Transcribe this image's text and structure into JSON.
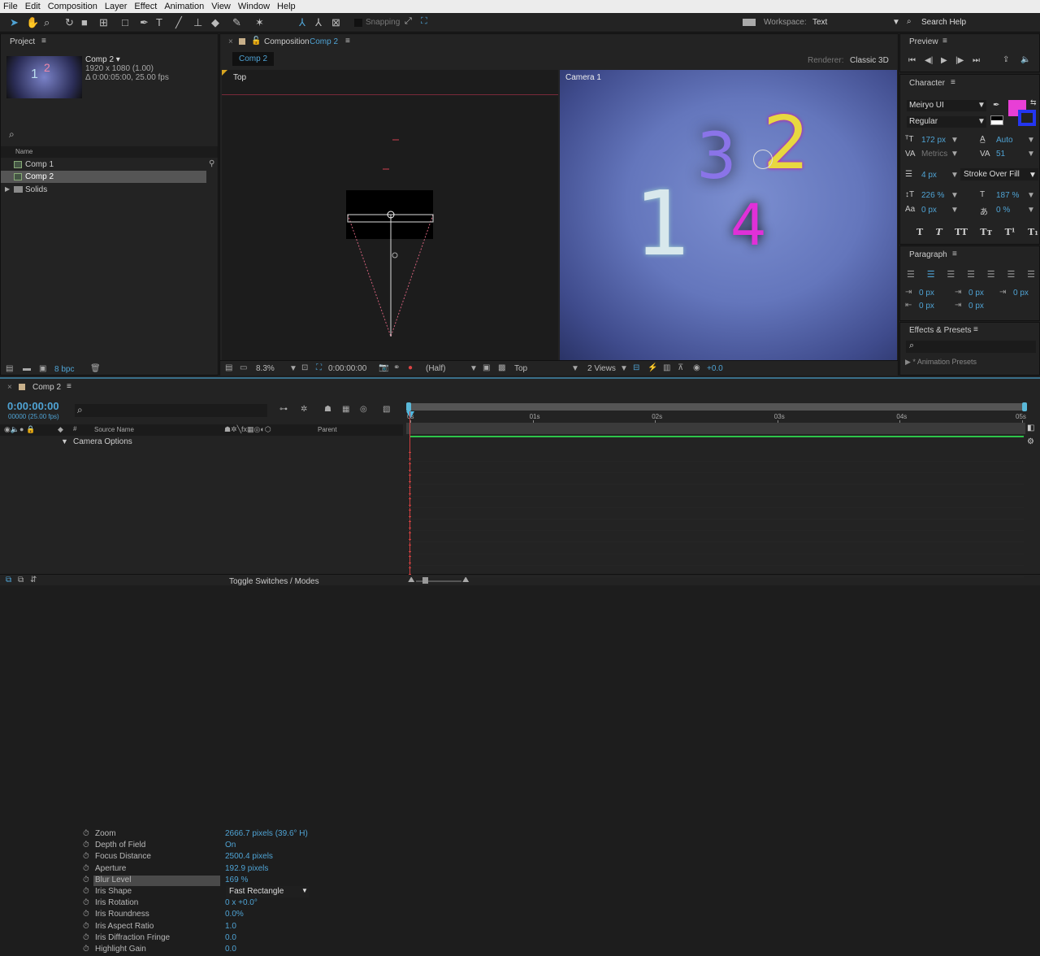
{
  "menu": [
    "File",
    "Edit",
    "Composition",
    "Layer",
    "Effect",
    "Animation",
    "View",
    "Window",
    "Help"
  ],
  "toolbar": {
    "snapping": "Snapping",
    "workspace_label": "Workspace:",
    "workspace": "Text",
    "search_help": "Search Help"
  },
  "project": {
    "title": "Project",
    "comp_name": "Comp 2 ▾",
    "resolution": "1920 x 1080 (1.00)",
    "duration": "Δ 0:00:05:00, 25.00 fps",
    "col_name": "Name",
    "items": [
      "Comp 1",
      "Comp 2",
      "Solids"
    ],
    "bpc": "8 bpc"
  },
  "composition": {
    "tab_prefix": "Composition",
    "tab_name": "Comp 2",
    "sub_tab": "Comp 2",
    "renderer_label": "Renderer:",
    "renderer": "Classic 3D",
    "left_view": "Top",
    "right_view": "Camera 1",
    "digits": [
      "1",
      "2",
      "3",
      "4"
    ]
  },
  "viewer_bar": {
    "zoom": "8.3%",
    "time": "0:00:00:00",
    "resolution": "(Half)",
    "view": "Top",
    "views": "2 Views",
    "exposure": "+0.0"
  },
  "preview": {
    "title": "Preview"
  },
  "character": {
    "title": "Character",
    "font": "Meiryo UI",
    "style": "Regular",
    "size": "172 px",
    "leading": "Auto",
    "kerning": "Metrics",
    "tracking": "51",
    "stroke": "4 px",
    "stroke_mode": "Stroke Over Fill",
    "vscale": "226 %",
    "hscale": "187 %",
    "baseline": "0 px",
    "tsume": "0 %",
    "fill_color": "#e83fd6",
    "stroke_color": "#2436f0",
    "styles": [
      "T",
      "T",
      "TT",
      "Tт",
      "T¹",
      "T₁"
    ]
  },
  "paragraph": {
    "title": "Paragraph",
    "indent_left": "0 px",
    "indent_first": "0 px",
    "indent_right": "0 px",
    "space_before": "0 px",
    "space_after": "0 px"
  },
  "effects": {
    "title": "Effects & Presets",
    "animation_presets": "* Animation Presets"
  },
  "timeline": {
    "tab": "Comp 2",
    "timecode": "0:00:00:00",
    "frames": "00000 (25.00 fps)",
    "col_source": "Source Name",
    "col_parent": "Parent",
    "group": "Camera Options",
    "toggle": "Toggle Switches / Modes",
    "ruler": [
      "0s",
      "01s",
      "02s",
      "03s",
      "04s",
      "05s"
    ],
    "properties": [
      {
        "name": "Zoom",
        "value": "2666.7 pixels (39.6° H)"
      },
      {
        "name": "Depth of Field",
        "value": "On"
      },
      {
        "name": "Focus Distance",
        "value": "2500.4 pixels"
      },
      {
        "name": "Aperture",
        "value": "192.9 pixels"
      },
      {
        "name": "Blur Level",
        "value": "169 %"
      },
      {
        "name": "Iris Shape",
        "value": "Fast Rectangle"
      },
      {
        "name": "Iris Rotation",
        "value": "0 x +0.0°"
      },
      {
        "name": "Iris Roundness",
        "value": "0.0%"
      },
      {
        "name": "Iris Aspect Ratio",
        "value": "1.0"
      },
      {
        "name": "Iris Diffraction Fringe",
        "value": "0.0"
      },
      {
        "name": "Highlight Gain",
        "value": "0.0"
      }
    ]
  }
}
